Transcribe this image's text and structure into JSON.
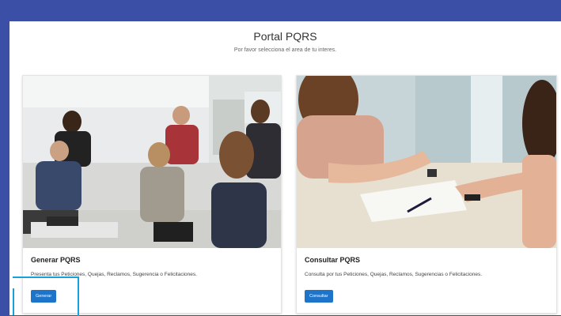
{
  "header": {
    "title": "Portal PQRS",
    "subtitle": "Por favor selecciona el area de tu interes."
  },
  "cards": [
    {
      "title": "Generar PQRS",
      "text": "Presenta tus Peticiones, Quejas, Reclamos, Sugerencia o Felicitaciones.",
      "button": "Generar",
      "photo": "office-team-meeting-photo"
    },
    {
      "title": "Consultar PQRS",
      "text": "Consulta por tus Peticiones, Quejas, Reclamos, Sugerencias o Felicitaciones.",
      "button": "Consultar",
      "photo": "document-signing-photo"
    }
  ],
  "colors": {
    "background": "#3b4fa6",
    "button": "#1d74c9",
    "focus_ring": "#1aa0d8"
  }
}
